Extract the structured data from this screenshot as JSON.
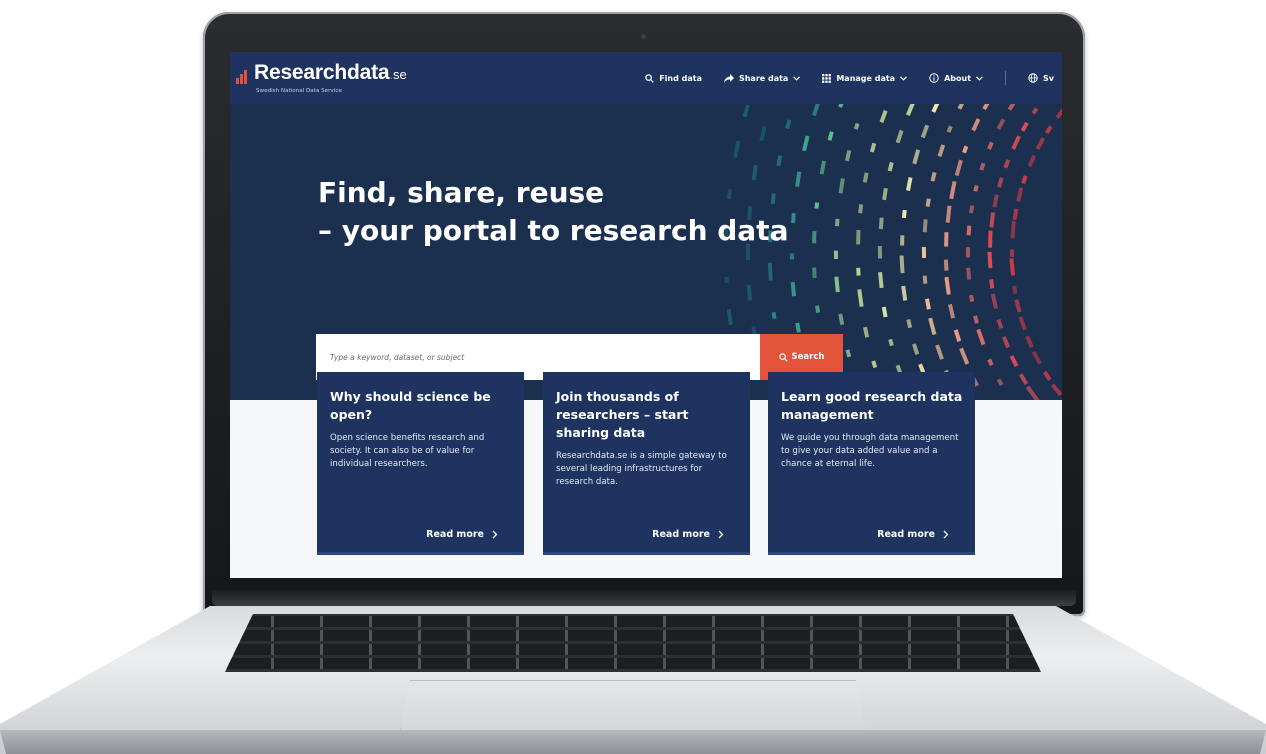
{
  "site": {
    "logo_main": "Researchdata",
    "logo_dot": ".",
    "logo_suffix": "se",
    "tagline": "Swedish National Data Service"
  },
  "nav": {
    "items": [
      {
        "label": "Find data",
        "icon": "search-icon",
        "has_dropdown": false
      },
      {
        "label": "Share data",
        "icon": "share-arrow-icon",
        "has_dropdown": true
      },
      {
        "label": "Manage data",
        "icon": "grid-icon",
        "has_dropdown": true
      },
      {
        "label": "About",
        "icon": "info-icon",
        "has_dropdown": true
      }
    ],
    "language": {
      "label": "Sv",
      "icon": "globe-icon"
    }
  },
  "hero": {
    "title_line1": "Find, share, reuse",
    "title_line2": "– your portal to research data"
  },
  "search": {
    "placeholder": "Type a keyword, dataset, or subject",
    "button_label": "Search"
  },
  "cards": [
    {
      "title": "Why should science be open?",
      "text": "Open science benefits research and society. It can also be of value for individual researchers.",
      "link": "Read more"
    },
    {
      "title": "Join thousands of researchers – start sharing data",
      "text": "Researchdata.se is a simple gateway to several leading infrastructures for research data.",
      "link": "Read more"
    },
    {
      "title": "Learn good research data management",
      "text": "We guide you through data management to give your data added value and a chance at eternal life.",
      "link": "Read more"
    }
  ],
  "colors": {
    "navy": "#1e3360",
    "hero_bg": "#1b2f4f",
    "accent": "#e2533a",
    "page_bg": "#f6f7f9"
  }
}
